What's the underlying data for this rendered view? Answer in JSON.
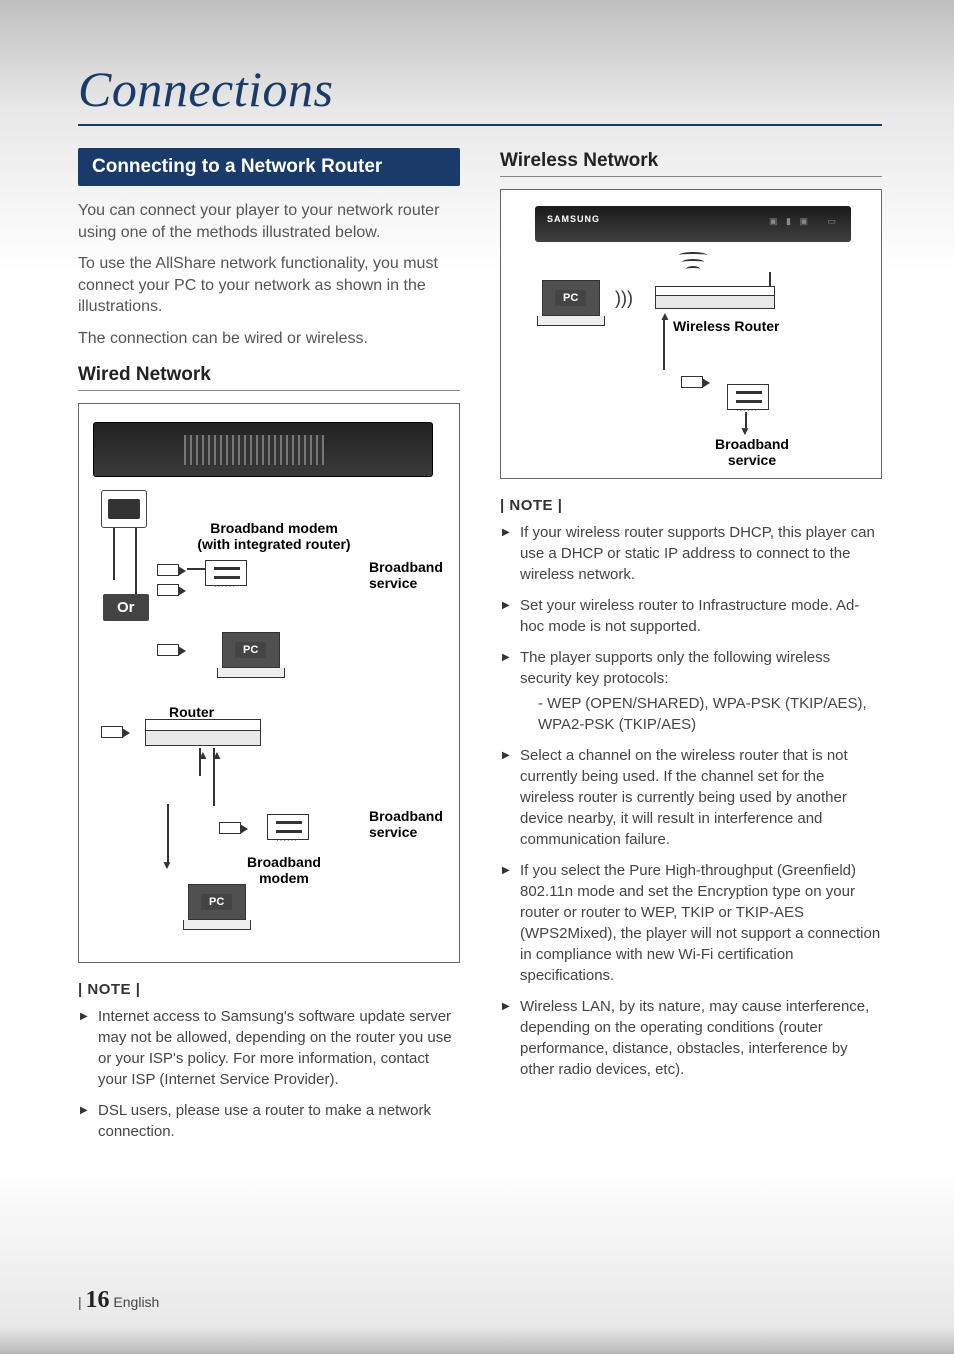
{
  "title": "Connections",
  "section_heading": "Connecting to a Network Router",
  "intro1": "You can connect your player to your network router using one of the methods illustrated below.",
  "intro2": "To use the AllShare network functionality, you must connect your PC to your network as shown in the illustrations.",
  "intro3": "The connection can be wired or wireless.",
  "wired_heading": "Wired Network",
  "wired_diagram": {
    "or": "Or",
    "bb_modem_integrated": "Broadband modem\n(with integrated router)",
    "bb_service": "Broadband service",
    "pc": "PC",
    "router": "Router",
    "bb_modem": "Broadband modem"
  },
  "wired_note_label": "| NOTE |",
  "wired_notes": [
    "Internet access to Samsung's software update server may not be allowed, depending on the router you use or your ISP's policy. For more information, contact your ISP (Internet Service Provider).",
    "DSL users, please use a router to make a network connection."
  ],
  "wireless_heading": "Wireless Network",
  "wireless_diagram": {
    "brand": "SAMSUNG",
    "pc": "PC",
    "wireless_router": "Wireless Router",
    "bb_service": "Broadband service"
  },
  "wireless_note_label": "| NOTE |",
  "wireless_notes": [
    "If your wireless router supports DHCP, this player can use a DHCP or static IP address to connect to the wireless network.",
    "Set your wireless router to Infrastructure mode. Ad-hoc mode is not supported.",
    "The player supports only the following wireless security key protocols:",
    "Select a channel on the wireless router that is not currently being used. If the channel set for the wireless router is currently being used by another device nearby, it will result in interference and communication failure.",
    "If you select the Pure High-throughput (Greenfield) 802.11n mode and set the Encryption type on your router or router to WEP, TKIP or TKIP-AES (WPS2Mixed), the player will not support a connection in compliance with new Wi-Fi certification specifications.",
    "Wireless LAN, by its nature, may cause interference, depending on the operating conditions (router performance, distance, obstacles, interference by other radio devices, etc)."
  ],
  "wireless_sub_note": "WEP (OPEN/SHARED), WPA-PSK (TKIP/AES), WPA2-PSK (TKIP/AES)",
  "footer": {
    "bar": "|",
    "page": "16",
    "lang": "English"
  }
}
